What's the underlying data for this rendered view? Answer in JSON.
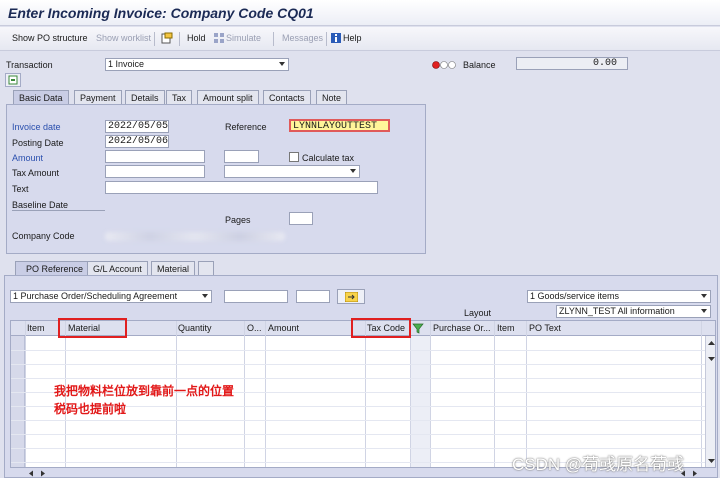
{
  "title": "Enter Incoming Invoice: Company Code CQ01",
  "toolbar": {
    "show_po_structure": "Show PO structure",
    "show_worklist": "Show worklist",
    "hold": "Hold",
    "simulate": "Simulate",
    "messages": "Messages",
    "help": "Help"
  },
  "header": {
    "transaction_label": "Transaction",
    "transaction_value": "1 Invoice",
    "balance_label": "Balance",
    "balance_value": "0.00"
  },
  "tabs": [
    "Basic Data",
    "Payment",
    "Details",
    "Tax",
    "Amount split",
    "Contacts",
    "Note"
  ],
  "basic_data": {
    "invoice_date_label": "Invoice date",
    "invoice_date": "2022/05/05",
    "posting_date_label": "Posting Date",
    "posting_date": "2022/05/06",
    "amount_label": "Amount",
    "calculate_tax_label": "Calculate tax",
    "tax_amount_label": "Tax Amount",
    "text_label": "Text",
    "baseline_date_label": "Baseline Date",
    "company_code_label": "Company Code",
    "reference_label": "Reference",
    "reference_value": "LYNNLAYOUTTEST",
    "pages_label": "Pages"
  },
  "lower_tabs": [
    "PO Reference",
    "G/L Account",
    "Material"
  ],
  "po_reference": {
    "reference_type": "1 Purchase Order/Scheduling Agreement",
    "goods_service": "1 Goods/service items",
    "layout_label": "Layout",
    "layout_value": "ZLYNN_TEST All information"
  },
  "grid": {
    "columns": [
      "Item",
      "Material",
      "Quantity",
      "O...",
      "Amount",
      "Tax Code",
      "Purchase Or...",
      "Item",
      "PO Text"
    ]
  },
  "annotation": {
    "line1": "我把物料栏位放到靠前一点的位置",
    "line2": "税码也提前啦"
  },
  "watermark": "CSDN @荀彧原名荀彧",
  "colors": {
    "accent_blue": "#2a4fae",
    "highlight_red": "#e02020",
    "reference_yellow": "#fff59a"
  },
  "icons": [
    "structure-icon",
    "hold-icon",
    "simulate-icon",
    "help-icon",
    "traffic-light-icon",
    "new-entry-icon",
    "filter-icon"
  ]
}
